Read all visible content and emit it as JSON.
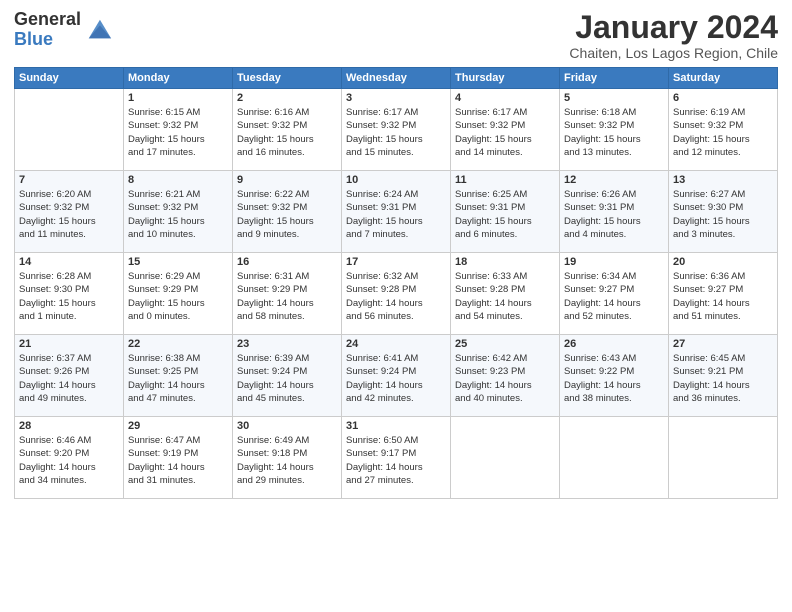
{
  "header": {
    "logo_general": "General",
    "logo_blue": "Blue",
    "title": "January 2024",
    "subtitle": "Chaiten, Los Lagos Region, Chile"
  },
  "days_of_week": [
    "Sunday",
    "Monday",
    "Tuesday",
    "Wednesday",
    "Thursday",
    "Friday",
    "Saturday"
  ],
  "weeks": [
    [
      {
        "day": "",
        "lines": []
      },
      {
        "day": "1",
        "lines": [
          "Sunrise: 6:15 AM",
          "Sunset: 9:32 PM",
          "Daylight: 15 hours",
          "and 17 minutes."
        ]
      },
      {
        "day": "2",
        "lines": [
          "Sunrise: 6:16 AM",
          "Sunset: 9:32 PM",
          "Daylight: 15 hours",
          "and 16 minutes."
        ]
      },
      {
        "day": "3",
        "lines": [
          "Sunrise: 6:17 AM",
          "Sunset: 9:32 PM",
          "Daylight: 15 hours",
          "and 15 minutes."
        ]
      },
      {
        "day": "4",
        "lines": [
          "Sunrise: 6:17 AM",
          "Sunset: 9:32 PM",
          "Daylight: 15 hours",
          "and 14 minutes."
        ]
      },
      {
        "day": "5",
        "lines": [
          "Sunrise: 6:18 AM",
          "Sunset: 9:32 PM",
          "Daylight: 15 hours",
          "and 13 minutes."
        ]
      },
      {
        "day": "6",
        "lines": [
          "Sunrise: 6:19 AM",
          "Sunset: 9:32 PM",
          "Daylight: 15 hours",
          "and 12 minutes."
        ]
      }
    ],
    [
      {
        "day": "7",
        "lines": [
          "Sunrise: 6:20 AM",
          "Sunset: 9:32 PM",
          "Daylight: 15 hours",
          "and 11 minutes."
        ]
      },
      {
        "day": "8",
        "lines": [
          "Sunrise: 6:21 AM",
          "Sunset: 9:32 PM",
          "Daylight: 15 hours",
          "and 10 minutes."
        ]
      },
      {
        "day": "9",
        "lines": [
          "Sunrise: 6:22 AM",
          "Sunset: 9:32 PM",
          "Daylight: 15 hours",
          "and 9 minutes."
        ]
      },
      {
        "day": "10",
        "lines": [
          "Sunrise: 6:24 AM",
          "Sunset: 9:31 PM",
          "Daylight: 15 hours",
          "and 7 minutes."
        ]
      },
      {
        "day": "11",
        "lines": [
          "Sunrise: 6:25 AM",
          "Sunset: 9:31 PM",
          "Daylight: 15 hours",
          "and 6 minutes."
        ]
      },
      {
        "day": "12",
        "lines": [
          "Sunrise: 6:26 AM",
          "Sunset: 9:31 PM",
          "Daylight: 15 hours",
          "and 4 minutes."
        ]
      },
      {
        "day": "13",
        "lines": [
          "Sunrise: 6:27 AM",
          "Sunset: 9:30 PM",
          "Daylight: 15 hours",
          "and 3 minutes."
        ]
      }
    ],
    [
      {
        "day": "14",
        "lines": [
          "Sunrise: 6:28 AM",
          "Sunset: 9:30 PM",
          "Daylight: 15 hours",
          "and 1 minute."
        ]
      },
      {
        "day": "15",
        "lines": [
          "Sunrise: 6:29 AM",
          "Sunset: 9:29 PM",
          "Daylight: 15 hours",
          "and 0 minutes."
        ]
      },
      {
        "day": "16",
        "lines": [
          "Sunrise: 6:31 AM",
          "Sunset: 9:29 PM",
          "Daylight: 14 hours",
          "and 58 minutes."
        ]
      },
      {
        "day": "17",
        "lines": [
          "Sunrise: 6:32 AM",
          "Sunset: 9:28 PM",
          "Daylight: 14 hours",
          "and 56 minutes."
        ]
      },
      {
        "day": "18",
        "lines": [
          "Sunrise: 6:33 AM",
          "Sunset: 9:28 PM",
          "Daylight: 14 hours",
          "and 54 minutes."
        ]
      },
      {
        "day": "19",
        "lines": [
          "Sunrise: 6:34 AM",
          "Sunset: 9:27 PM",
          "Daylight: 14 hours",
          "and 52 minutes."
        ]
      },
      {
        "day": "20",
        "lines": [
          "Sunrise: 6:36 AM",
          "Sunset: 9:27 PM",
          "Daylight: 14 hours",
          "and 51 minutes."
        ]
      }
    ],
    [
      {
        "day": "21",
        "lines": [
          "Sunrise: 6:37 AM",
          "Sunset: 9:26 PM",
          "Daylight: 14 hours",
          "and 49 minutes."
        ]
      },
      {
        "day": "22",
        "lines": [
          "Sunrise: 6:38 AM",
          "Sunset: 9:25 PM",
          "Daylight: 14 hours",
          "and 47 minutes."
        ]
      },
      {
        "day": "23",
        "lines": [
          "Sunrise: 6:39 AM",
          "Sunset: 9:24 PM",
          "Daylight: 14 hours",
          "and 45 minutes."
        ]
      },
      {
        "day": "24",
        "lines": [
          "Sunrise: 6:41 AM",
          "Sunset: 9:24 PM",
          "Daylight: 14 hours",
          "and 42 minutes."
        ]
      },
      {
        "day": "25",
        "lines": [
          "Sunrise: 6:42 AM",
          "Sunset: 9:23 PM",
          "Daylight: 14 hours",
          "and 40 minutes."
        ]
      },
      {
        "day": "26",
        "lines": [
          "Sunrise: 6:43 AM",
          "Sunset: 9:22 PM",
          "Daylight: 14 hours",
          "and 38 minutes."
        ]
      },
      {
        "day": "27",
        "lines": [
          "Sunrise: 6:45 AM",
          "Sunset: 9:21 PM",
          "Daylight: 14 hours",
          "and 36 minutes."
        ]
      }
    ],
    [
      {
        "day": "28",
        "lines": [
          "Sunrise: 6:46 AM",
          "Sunset: 9:20 PM",
          "Daylight: 14 hours",
          "and 34 minutes."
        ]
      },
      {
        "day": "29",
        "lines": [
          "Sunrise: 6:47 AM",
          "Sunset: 9:19 PM",
          "Daylight: 14 hours",
          "and 31 minutes."
        ]
      },
      {
        "day": "30",
        "lines": [
          "Sunrise: 6:49 AM",
          "Sunset: 9:18 PM",
          "Daylight: 14 hours",
          "and 29 minutes."
        ]
      },
      {
        "day": "31",
        "lines": [
          "Sunrise: 6:50 AM",
          "Sunset: 9:17 PM",
          "Daylight: 14 hours",
          "and 27 minutes."
        ]
      },
      {
        "day": "",
        "lines": []
      },
      {
        "day": "",
        "lines": []
      },
      {
        "day": "",
        "lines": []
      }
    ]
  ]
}
